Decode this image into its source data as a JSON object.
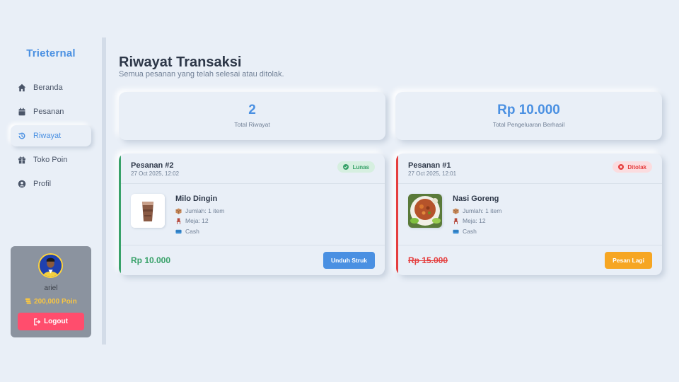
{
  "sidebar": {
    "brand": "Trieternal",
    "items": [
      {
        "label": "Beranda",
        "icon": "home-icon"
      },
      {
        "label": "Pesanan",
        "icon": "calendar-icon"
      },
      {
        "label": "Riwayat",
        "icon": "history-icon",
        "active": true
      },
      {
        "label": "Toko Poin",
        "icon": "gift-icon"
      },
      {
        "label": "Profil",
        "icon": "user-circle-icon"
      }
    ],
    "profile": {
      "username": "ariel",
      "points": "200,000 Poin",
      "logout_label": "Logout"
    }
  },
  "main": {
    "title": "Riwayat Transaksi",
    "subtitle": "Semua pesanan yang telah selesai atau ditolak.",
    "stats": [
      {
        "value": "2",
        "label": "Total Riwayat"
      },
      {
        "value": "Rp 10.000",
        "label": "Total Pengeluaran Berhasil"
      }
    ],
    "orders": [
      {
        "title": "Pesanan #2",
        "date": "27 Oct 2025, 12:02",
        "status": "Lunas",
        "item_name": "Milo Dingin",
        "quantity": "Jumlah: 1 item",
        "table": "Meja: 12",
        "payment": "Cash",
        "price": "Rp 10.000",
        "action_label": "Unduh Struk"
      },
      {
        "title": "Pesanan #1",
        "date": "27 Oct 2025, 12:01",
        "status": "Ditolak",
        "item_name": "Nasi Goreng",
        "quantity": "Jumlah: 1 item",
        "table": "Meja: 12",
        "payment": "Cash",
        "price": "Rp 15.000",
        "action_label": "Pesan Lagi"
      }
    ]
  },
  "colors": {
    "accent": "#4a90e2",
    "success": "#38a169",
    "danger": "#e53e3e",
    "warning": "#f6a623",
    "logout": "#ff4d6d",
    "points": "#f6c544"
  }
}
